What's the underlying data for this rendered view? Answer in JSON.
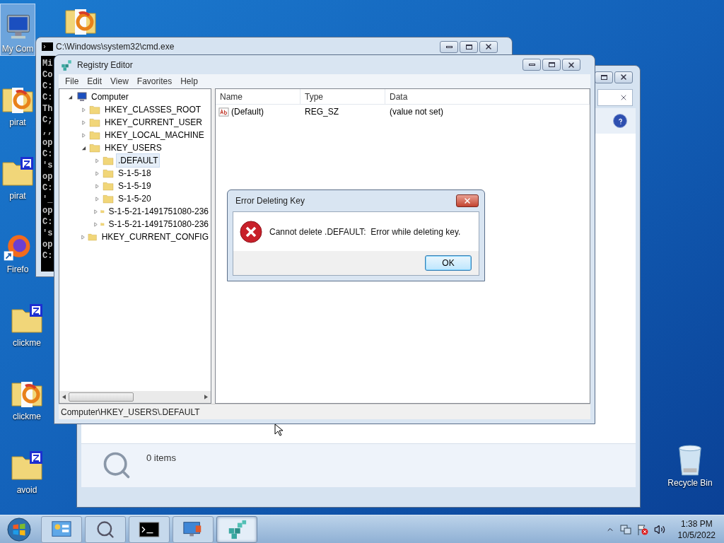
{
  "desktop_left_column": [
    {
      "label": "My Com",
      "kind": "computer",
      "selected": true
    },
    {
      "label": "pirat",
      "kind": "folder-pdf",
      "selected": false
    },
    {
      "label": "pirat",
      "kind": "folder-zip",
      "selected": false
    },
    {
      "label": "Firefo",
      "kind": "browser",
      "selected": false
    },
    {
      "label": "clickme",
      "kind": "folder-zip",
      "selected": false
    },
    {
      "label": "clickme",
      "kind": "folder-pdf",
      "selected": false
    },
    {
      "label": "avoid",
      "kind": "folder-zip",
      "selected": false
    }
  ],
  "desktop_top_icon": {
    "kind": "folder-pdf"
  },
  "recycle_bin": {
    "label": "Recycle Bin"
  },
  "explorer_window": {
    "details_text": "0 items"
  },
  "cmd_window": {
    "title": "C:\\Windows\\system32\\cmd.exe",
    "lines": [
      "Mi",
      "Co",
      "C:",
      "C:",
      "Th",
      "C;",
      ",,",
      "op",
      "C:",
      "'s",
      "op",
      "C:",
      "'_",
      "op",
      "C:",
      "'s",
      "op",
      "C:"
    ]
  },
  "registry": {
    "title": "Registry Editor",
    "menu": [
      "File",
      "Edit",
      "View",
      "Favorites",
      "Help"
    ],
    "tree": [
      {
        "label": "Computer",
        "expanded": true,
        "selected": false,
        "kind": "computer",
        "children": [
          {
            "label": "HKEY_CLASSES_ROOT",
            "expanded": false,
            "selected": false
          },
          {
            "label": "HKEY_CURRENT_USER",
            "expanded": false,
            "selected": false
          },
          {
            "label": "HKEY_LOCAL_MACHINE",
            "expanded": false,
            "selected": false
          },
          {
            "label": "HKEY_USERS",
            "expanded": true,
            "selected": false,
            "children": [
              {
                "label": ".DEFAULT",
                "expanded": false,
                "selected": true
              },
              {
                "label": "S-1-5-18",
                "expanded": false,
                "selected": false
              },
              {
                "label": "S-1-5-19",
                "expanded": false,
                "selected": false
              },
              {
                "label": "S-1-5-20",
                "expanded": false,
                "selected": false
              },
              {
                "label": "S-1-5-21-1491751080-236",
                "expanded": false,
                "selected": false
              },
              {
                "label": "S-1-5-21-1491751080-236",
                "expanded": false,
                "selected": false
              }
            ]
          },
          {
            "label": "HKEY_CURRENT_CONFIG",
            "expanded": false,
            "selected": false
          }
        ]
      }
    ],
    "columns": [
      "Name",
      "Type",
      "Data"
    ],
    "rows": [
      {
        "name": "(Default)",
        "type": "REG_SZ",
        "data": "(value not set)"
      }
    ],
    "status": "Computer\\HKEY_USERS\\.DEFAULT"
  },
  "dialog": {
    "title": "Error Deleting Key",
    "message": "Cannot delete .DEFAULT:  Error while deleting key.",
    "button": "OK"
  },
  "taskbar": {
    "buttons": [
      {
        "kind": "control-panel",
        "selected": false
      },
      {
        "kind": "search",
        "selected": false
      },
      {
        "kind": "cmd",
        "selected": false
      },
      {
        "kind": "remote",
        "selected": false
      },
      {
        "kind": "regedit",
        "selected": true
      }
    ],
    "time": "1:38 PM",
    "date": "10/5/2022"
  }
}
